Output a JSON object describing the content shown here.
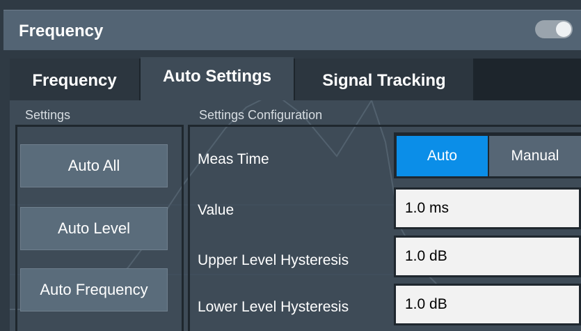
{
  "dialog": {
    "title": "Frequency",
    "toggle_state": "on"
  },
  "tabs": [
    {
      "label": "Frequency",
      "active": false
    },
    {
      "label": "Auto Settings",
      "active": true
    },
    {
      "label": "Signal Tracking",
      "active": false
    }
  ],
  "settings_group": {
    "label": "Settings",
    "buttons": [
      {
        "label": "Auto All"
      },
      {
        "label": "Auto Level"
      },
      {
        "label": "Auto Frequency"
      }
    ]
  },
  "config_group": {
    "label": "Settings Configuration",
    "meas_time": {
      "label": "Meas Time",
      "options": [
        "Auto",
        "Manual"
      ],
      "selected": "Auto"
    },
    "value": {
      "label": "Value",
      "value": "1.0 ms"
    },
    "upper_hysteresis": {
      "label": "Upper Level Hysteresis",
      "value": "1.0 dB"
    },
    "lower_hysteresis": {
      "label": "Lower Level Hysteresis",
      "value": "1.0 dB"
    }
  },
  "colors": {
    "accent": "#0b8ee8",
    "title_bar": "#536474",
    "panel": "#3e4b57"
  }
}
